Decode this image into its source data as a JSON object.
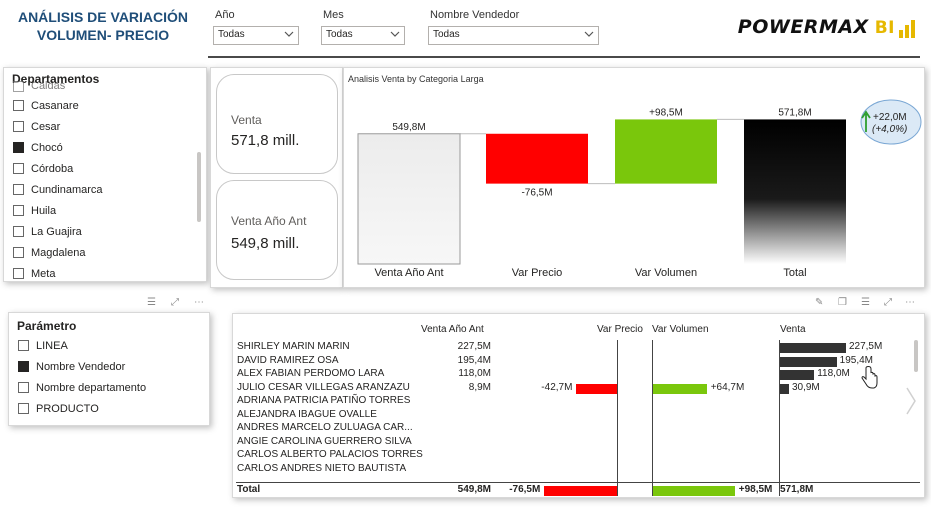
{
  "header": {
    "title_line1": "ANÁLISIS DE VARIACIÓN",
    "title_line2": "VOLUMEN- PRECIO",
    "filters": [
      {
        "label": "Año",
        "value": "Todas"
      },
      {
        "label": "Mes",
        "value": "Todas"
      },
      {
        "label": "Nombre Vendedor",
        "value": "Todas"
      }
    ],
    "logo_text": "POWERMAX",
    "logo_bi": "BI"
  },
  "departamentos": {
    "title": "Departamentos",
    "partial_item": "Caldas",
    "items": [
      {
        "label": "Casanare",
        "checked": false
      },
      {
        "label": "Cesar",
        "checked": false
      },
      {
        "label": "Chocó",
        "checked": true
      },
      {
        "label": "Córdoba",
        "checked": false
      },
      {
        "label": "Cundinamarca",
        "checked": false
      },
      {
        "label": "Huila",
        "checked": false
      },
      {
        "label": "La Guajira",
        "checked": false
      },
      {
        "label": "Magdalena",
        "checked": false
      },
      {
        "label": "Meta",
        "checked": false
      }
    ]
  },
  "cards": [
    {
      "label": "Venta",
      "value": "571,8 mill."
    },
    {
      "label": "Venta Año Ant",
      "value": "549,8 mill."
    }
  ],
  "chart_data": {
    "type": "bar",
    "subtype": "waterfall",
    "title": "Analisis Venta by Categoria Larga",
    "categories": [
      "Venta Año Ant",
      "Var Precio",
      "Var Volumen",
      "Total"
    ],
    "values": [
      549.8,
      -76.5,
      98.5,
      571.8
    ],
    "data_labels": [
      "549,8M",
      "-76,5M",
      "+98,5M",
      "571,8M"
    ],
    "colors": [
      "#f0f0f0",
      "#ff0000",
      "#7ac70c",
      "#000000"
    ],
    "ylim": [
      350,
      620
    ],
    "annotation": {
      "line1": "+22,0M",
      "line2": "(+4,0%)"
    }
  },
  "parametro": {
    "title": "Parámetro",
    "items": [
      {
        "label": "LINEA",
        "checked": false
      },
      {
        "label": "Nombre Vendedor",
        "checked": true
      },
      {
        "label": "Nombre departamento",
        "checked": false
      },
      {
        "label": "PRODUCTO",
        "checked": false
      }
    ]
  },
  "table": {
    "headers": {
      "prev": "Venta Año Ant",
      "precio": "Var Precio",
      "volumen": "Var Volumen",
      "venta": "Venta"
    },
    "rows": [
      {
        "name": "SHIRLEY MARIN MARIN",
        "prev": "227,5M",
        "precio": "",
        "precio_val": 0,
        "volumen": "",
        "volumen_val": 0,
        "venta": "227,5M",
        "venta_val": 227.5
      },
      {
        "name": "DAVID RAMIREZ OSA",
        "prev": "195,4M",
        "precio": "",
        "precio_val": 0,
        "volumen": "",
        "volumen_val": 0,
        "venta": "195,4M",
        "venta_val": 195.4
      },
      {
        "name": "ALEX FABIAN PERDOMO LARA",
        "prev": "118,0M",
        "precio": "",
        "precio_val": 0,
        "volumen": "",
        "volumen_val": 0,
        "venta": "118,0M",
        "venta_val": 118.0
      },
      {
        "name": "JULIO CESAR VILLEGAS ARANZAZU",
        "prev": "8,9M",
        "precio": "-42,7M",
        "precio_val": -42.7,
        "volumen": "+64,7M",
        "volumen_val": 64.7,
        "venta": "30,9M",
        "venta_val": 30.9
      },
      {
        "name": "ADRIANA PATRICIA PATIÑO TORRES",
        "prev": "",
        "precio": "",
        "precio_val": 0,
        "volumen": "",
        "volumen_val": 0,
        "venta": "",
        "venta_val": 0
      },
      {
        "name": "ALEJANDRA IBAGUE OVALLE",
        "prev": "",
        "precio": "",
        "precio_val": 0,
        "volumen": "",
        "volumen_val": 0,
        "venta": "",
        "venta_val": 0
      },
      {
        "name": "ANDRES MARCELO ZULUAGA CAR...",
        "prev": "",
        "precio": "",
        "precio_val": 0,
        "volumen": "",
        "volumen_val": 0,
        "venta": "",
        "venta_val": 0
      },
      {
        "name": "ANGIE CAROLINA GUERRERO SILVA",
        "prev": "",
        "precio": "",
        "precio_val": 0,
        "volumen": "",
        "volumen_val": 0,
        "venta": "",
        "venta_val": 0
      },
      {
        "name": "CARLOS ALBERTO PALACIOS TORRES",
        "prev": "",
        "precio": "",
        "precio_val": 0,
        "volumen": "",
        "volumen_val": 0,
        "venta": "",
        "venta_val": 0
      },
      {
        "name": "CARLOS ANDRES NIETO BAUTISTA",
        "prev": "",
        "precio": "",
        "precio_val": 0,
        "volumen": "",
        "volumen_val": 0,
        "venta": "",
        "venta_val": 0
      }
    ],
    "total": {
      "name": "Total",
      "prev": "549,8M",
      "precio": "-76,5M",
      "precio_val": -76.5,
      "volumen": "+98,5M",
      "volumen_val": 98.5,
      "venta": "571,8M"
    }
  }
}
